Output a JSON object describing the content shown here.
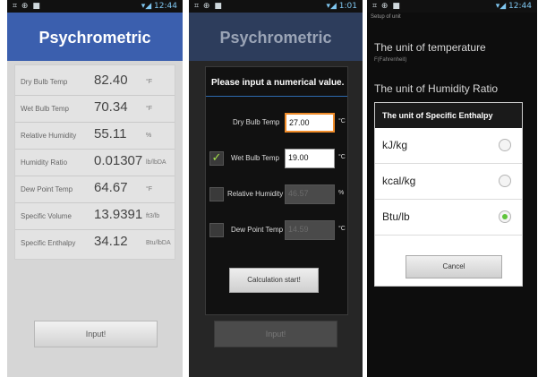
{
  "status": {
    "left_icons": "⌗ ⊕ ■",
    "right_1": "▾◢ 12:44",
    "right_2": "▾◢ 1:01",
    "right_3": "▾◢ 12:44"
  },
  "screen1": {
    "title": "Psychrometric",
    "rows": [
      {
        "label": "Dry Bulb Temp",
        "value": "82.40",
        "unit": "°F"
      },
      {
        "label": "Wet Bulb Temp",
        "value": "70.34",
        "unit": "°F"
      },
      {
        "label": "Relative Humidity",
        "value": "55.11",
        "unit": "%"
      },
      {
        "label": "Humidity Ratio",
        "value": "0.01307",
        "unit": "lb/lbDA"
      },
      {
        "label": "Dew Point Temp",
        "value": "64.67",
        "unit": "°F"
      },
      {
        "label": "Specific Volume",
        "value": "13.9391",
        "unit": "ft3/lb"
      },
      {
        "label": "Specific Enthalpy",
        "value": "34.12",
        "unit": "Btu/lbDA"
      }
    ],
    "input_label": "Input!"
  },
  "screen2": {
    "title": "Psychrometric",
    "dialog_title": "Please input a numerical value.",
    "rows": [
      {
        "label": "Dry Bulb Temp",
        "value": "27.00",
        "unit": "°C"
      },
      {
        "label": "Wet Bulb Temp",
        "value": "19.00",
        "unit": "°C"
      },
      {
        "label": "Relative Humidity",
        "value": "46.57",
        "unit": "%"
      },
      {
        "label": "Dew Point Temp",
        "value": "14.59",
        "unit": "°C"
      }
    ],
    "checkmark": "✓",
    "calc_label": "Calculation start!",
    "behind_input_label": "Input!"
  },
  "screen3": {
    "crumb": "Setup of unit",
    "pref1_title": "The unit of temperature",
    "pref1_sub": "F(Fahrenheit)",
    "pref2_title": "The unit of Humidity Ratio",
    "dialog_title": "The unit of Specific Enthalpy",
    "options": [
      {
        "label": "kJ/kg",
        "selected": false
      },
      {
        "label": "kcal/kg",
        "selected": false
      },
      {
        "label": "Btu/lb",
        "selected": true
      }
    ],
    "cancel_label": "Cancel"
  }
}
